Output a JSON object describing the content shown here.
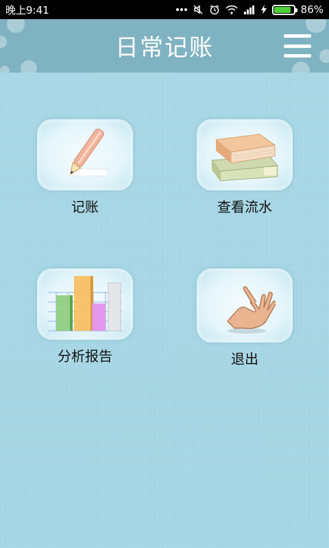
{
  "status_bar": {
    "time": "晚上9:41",
    "battery_percent": "86%",
    "battery_level": 0.86,
    "icons": [
      "more-dots-icon",
      "mute-icon",
      "alarm-icon",
      "wifi-icon",
      "signal-icon",
      "charging-icon",
      "battery-icon"
    ]
  },
  "header": {
    "title": "日常记账",
    "menu_icon": "menu-icon",
    "background_color": "#7fb3c2"
  },
  "tiles": [
    {
      "label": "记账",
      "icon": "pencil-icon"
    },
    {
      "label": "查看流水",
      "icon": "books-icon"
    },
    {
      "label": "分析报告",
      "icon": "bar-chart-icon"
    },
    {
      "label": "退出",
      "icon": "hand-icon"
    }
  ],
  "colors": {
    "background": "#a9d8e6",
    "status_bar": "#000000",
    "battery_fill": "#4cd236"
  }
}
